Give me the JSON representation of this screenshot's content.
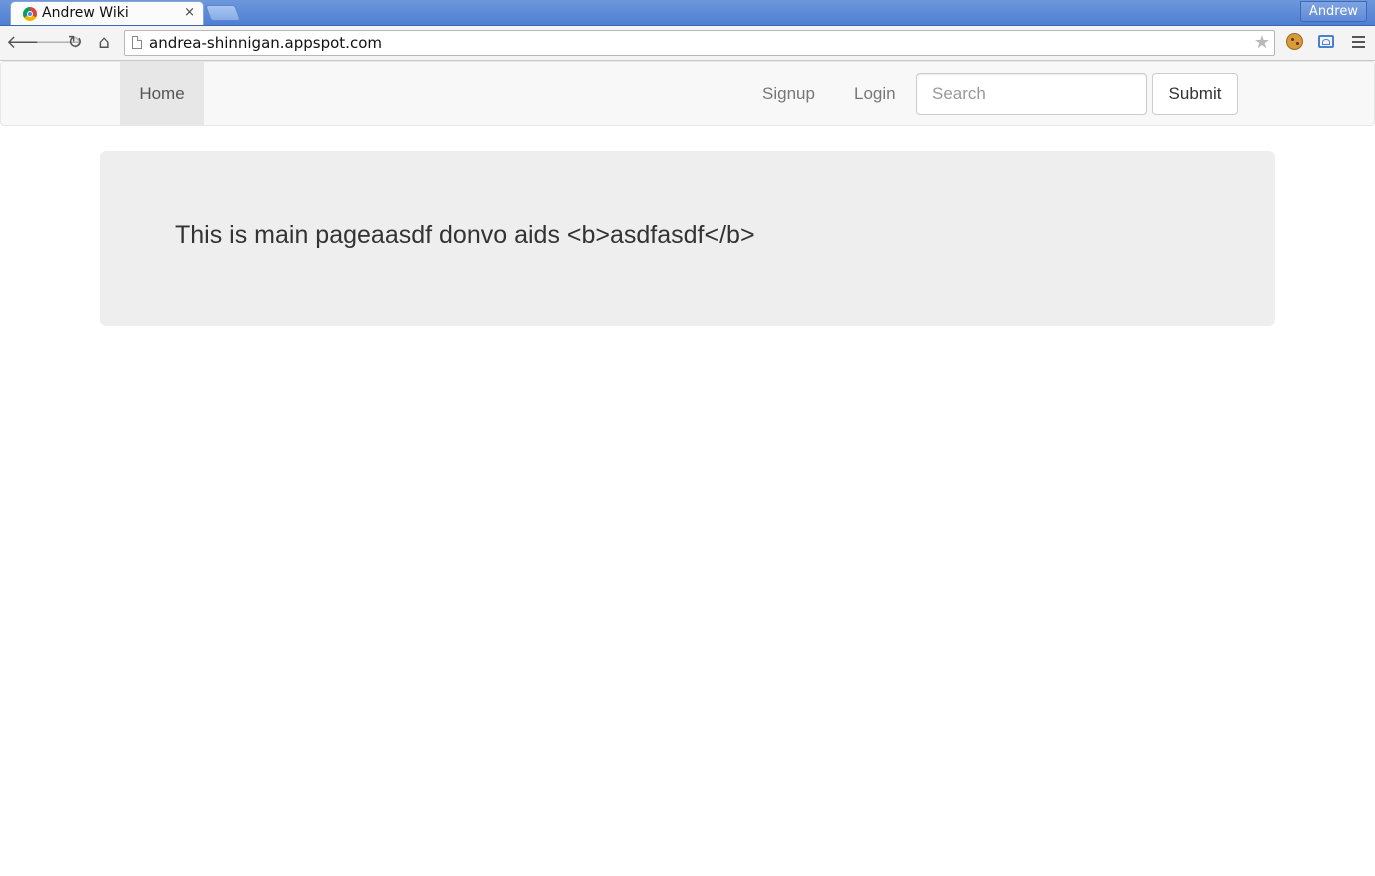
{
  "browser": {
    "tab": {
      "title": "Andrew Wiki",
      "close_glyph": "×",
      "favicon": "appengine-favicon-icon"
    },
    "profile_name": "Andrew",
    "toolbar": {
      "back_glyph": "🡐",
      "forward_glyph": "🡒",
      "reload_glyph": "↻",
      "home_glyph": "⌂",
      "url": "andrea-shinnigan.appspot.com",
      "bookmark_glyph": "★"
    },
    "extensions": [
      "cookie-extension-icon",
      "cast-extension-icon"
    ]
  },
  "navbar": {
    "home_label": "Home",
    "signup_label": "Signup",
    "login_label": "Login",
    "search_placeholder": "Search",
    "search_value": "",
    "submit_label": "Submit"
  },
  "main": {
    "text": "This is main pageaasdf donvo aids <b>asdfasdf</b>"
  },
  "colors": {
    "tabstrip": "#4e7fd2",
    "navbar_bg": "#f8f8f8",
    "active_nav_bg": "#e7e7e7",
    "jumbotron_bg": "#eeeeee"
  }
}
